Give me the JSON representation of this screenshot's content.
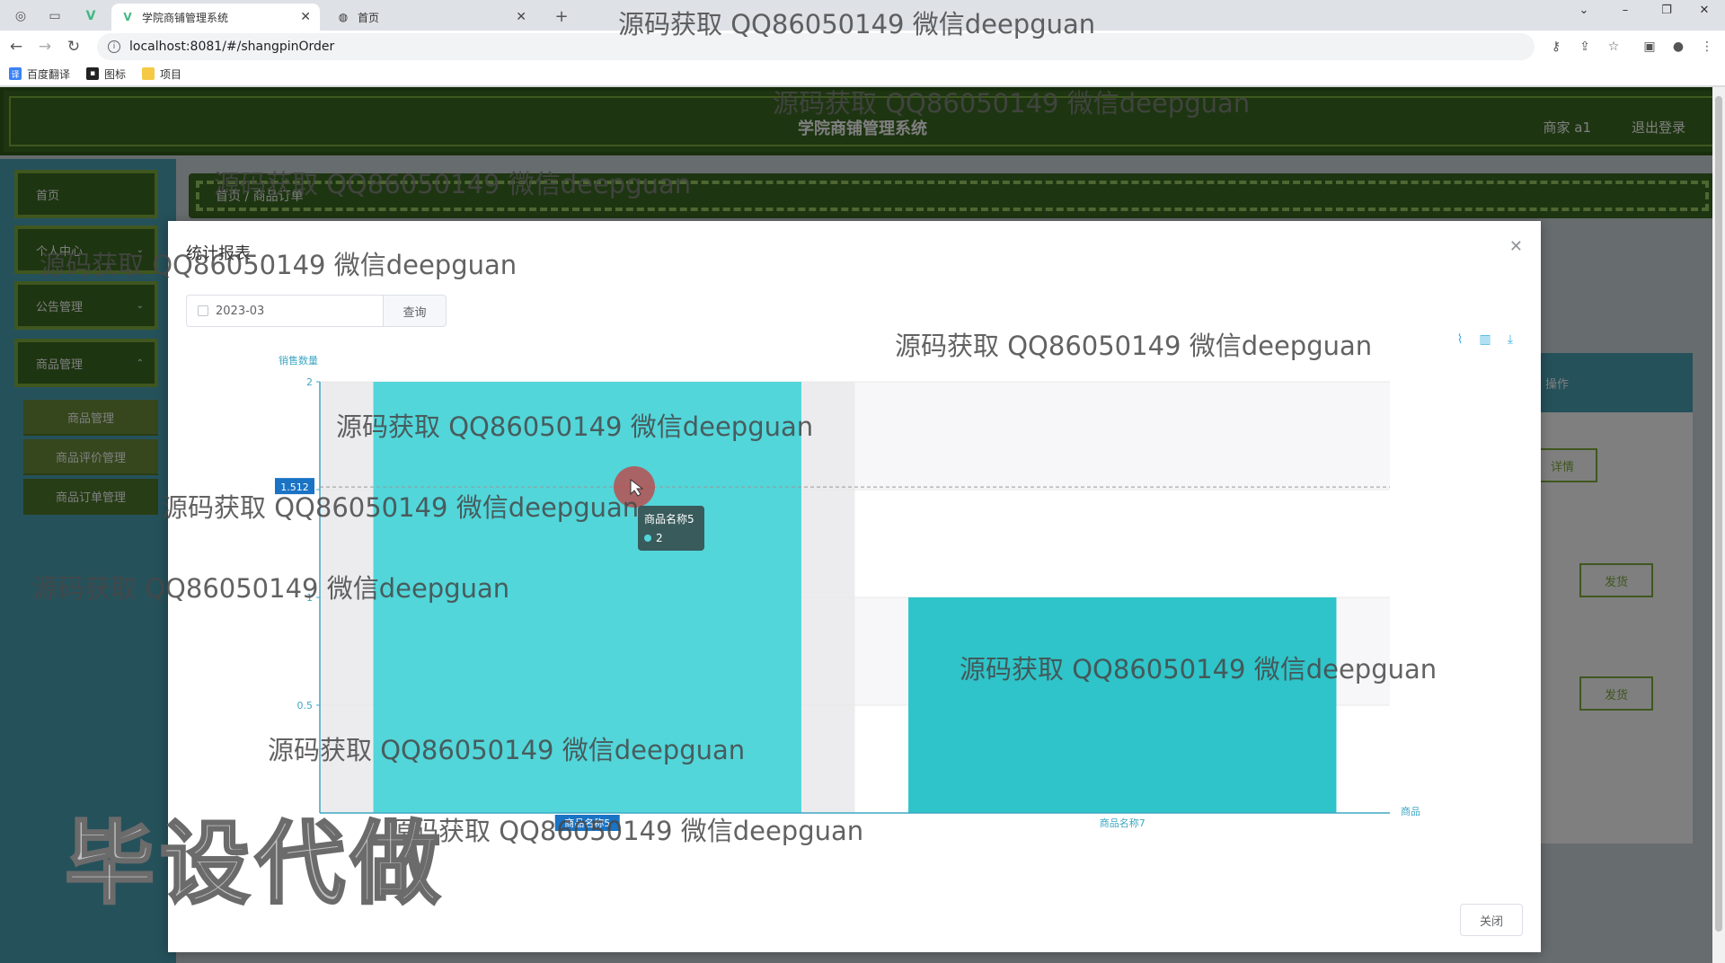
{
  "browser": {
    "tabs": [
      {
        "title": "学院商铺管理系统",
        "active": true
      },
      {
        "title": "首页",
        "active": false
      }
    ],
    "url": "localhost:8081/#/shangpinOrder",
    "bookmarks": [
      "百度翻译",
      "图标",
      "项目"
    ],
    "new_tab_label": "+"
  },
  "app": {
    "title": "学院商铺管理系统",
    "user": "商家 a1",
    "logout": "退出登录",
    "sidebar": {
      "items": [
        {
          "label": "首页"
        },
        {
          "label": "个人中心"
        },
        {
          "label": "公告管理"
        },
        {
          "label": "商品管理"
        }
      ],
      "subitems": [
        {
          "label": "商品管理"
        },
        {
          "label": "商品评价管理"
        },
        {
          "label": "商品订单管理"
        }
      ]
    },
    "breadcrumb": "首页 / 商品订单",
    "table": {
      "header": "操作",
      "buttons": [
        "详情",
        "发货",
        "发货"
      ]
    }
  },
  "dialog": {
    "title": "统计报表",
    "month_value": "2023-03",
    "query_label": "查询",
    "close_label": "关闭",
    "toolbar_icons": [
      "line-chart-icon",
      "bar-chart-icon",
      "download-icon"
    ]
  },
  "chart_data": {
    "type": "bar",
    "title": "",
    "xlabel": "商品",
    "ylabel": "销售数量",
    "categories": [
      "商品名称5",
      "商品名称7"
    ],
    "values": [
      2,
      1
    ],
    "ylim": [
      0,
      2
    ],
    "yticks": [
      0.5,
      1,
      1.5,
      2
    ],
    "colors": [
      "#52d6da",
      "#2ec4c9"
    ],
    "pointer_y_label": "1.512",
    "tooltip": {
      "name": "商品名称5",
      "value": "2"
    },
    "grid": true
  },
  "watermark": {
    "text": "源码获取 QQ86050149 微信deepguan",
    "big_text": "毕设代做"
  }
}
